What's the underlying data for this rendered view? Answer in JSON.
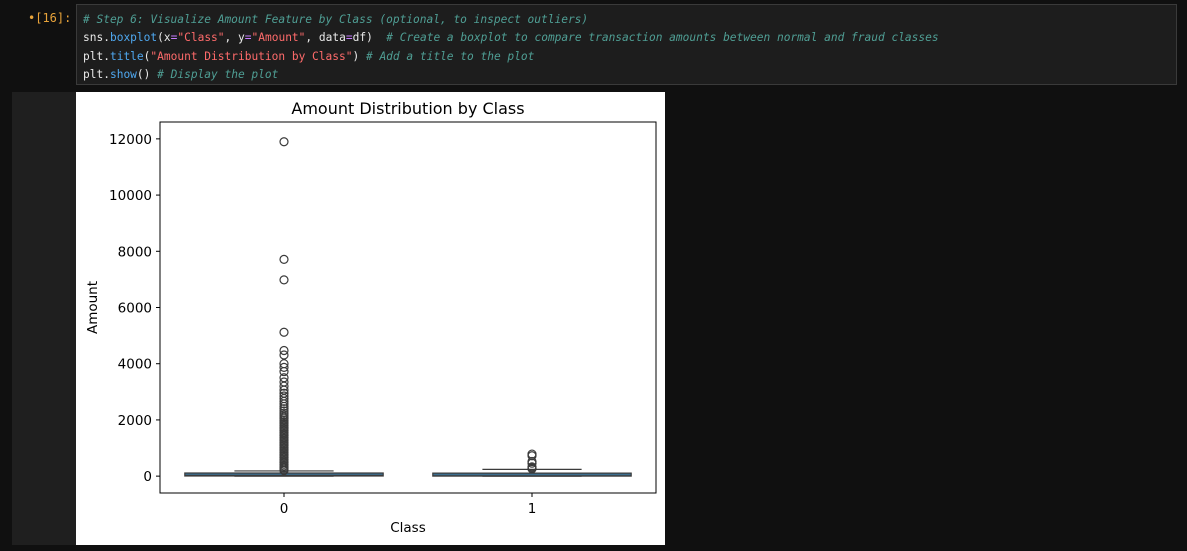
{
  "cell": {
    "prompt_symbol": "•",
    "prompt_label": "[16]:",
    "code_lines": [
      [
        {
          "t": "# Step 6: Visualize Amount Feature by Class (optional, to inspect outliers)",
          "c": "com"
        }
      ],
      [
        {
          "t": "sns",
          "c": "var"
        },
        {
          "t": ".",
          "c": "pun"
        },
        {
          "t": "boxplot",
          "c": "fn"
        },
        {
          "t": "(",
          "c": "pun"
        },
        {
          "t": "x",
          "c": "arg"
        },
        {
          "t": "=",
          "c": "eq"
        },
        {
          "t": "\"Class\"",
          "c": "str"
        },
        {
          "t": ", ",
          "c": "pun"
        },
        {
          "t": "y",
          "c": "arg"
        },
        {
          "t": "=",
          "c": "eq"
        },
        {
          "t": "\"Amount\"",
          "c": "str"
        },
        {
          "t": ", ",
          "c": "pun"
        },
        {
          "t": "data",
          "c": "arg"
        },
        {
          "t": "=",
          "c": "eq"
        },
        {
          "t": "df",
          "c": "var"
        },
        {
          "t": ")  ",
          "c": "pun"
        },
        {
          "t": "# Create a boxplot to compare transaction amounts between normal and fraud classes",
          "c": "com"
        }
      ],
      [
        {
          "t": "plt",
          "c": "var"
        },
        {
          "t": ".",
          "c": "pun"
        },
        {
          "t": "title",
          "c": "fn"
        },
        {
          "t": "(",
          "c": "pun"
        },
        {
          "t": "\"Amount Distribution by Class\"",
          "c": "str"
        },
        {
          "t": ") ",
          "c": "pun"
        },
        {
          "t": "# Add a title to the plot",
          "c": "com"
        }
      ],
      [
        {
          "t": "plt",
          "c": "var"
        },
        {
          "t": ".",
          "c": "pun"
        },
        {
          "t": "show",
          "c": "fn"
        },
        {
          "t": "() ",
          "c": "pun"
        },
        {
          "t": "# Display the plot",
          "c": "com"
        }
      ]
    ]
  },
  "colors": {
    "box_fill": "#3c6e8f",
    "line": "#3b3b3b",
    "prompt": "#e8a33a"
  },
  "chart_data": {
    "type": "box",
    "title": "Amount Distribution by Class",
    "xlabel": "Class",
    "ylabel": "Amount",
    "categories": [
      "0",
      "1"
    ],
    "ylim": [
      -600,
      12600
    ],
    "yticks": [
      0,
      2000,
      4000,
      6000,
      8000,
      10000,
      12000
    ],
    "boxes": [
      {
        "category": "0",
        "whisker_low": 0,
        "q1": 5,
        "median": 22,
        "q3": 77,
        "whisker_high": 185,
        "outliers": [
          11898,
          7712,
          6982,
          5120,
          4470,
          4310,
          4000,
          3870,
          3720,
          3500,
          3350,
          3200,
          3060,
          2950,
          2850,
          2760,
          2660,
          2570,
          2480,
          2400,
          2320,
          2240,
          2170,
          2100,
          2040,
          1980,
          1920,
          1860,
          1800,
          1740,
          1680,
          1620,
          1560,
          1500,
          1440,
          1380,
          1320,
          1260,
          1200,
          1140,
          1080,
          1020,
          960,
          900,
          840,
          780,
          720,
          660,
          600,
          540,
          480,
          420,
          360,
          300,
          250,
          200
        ]
      },
      {
        "category": "1",
        "whisker_low": 0,
        "q1": 1,
        "median": 9,
        "q3": 105,
        "whisker_high": 240,
        "outliers": [
          785,
          725,
          520,
          460,
          330,
          290,
          265
        ]
      }
    ]
  }
}
